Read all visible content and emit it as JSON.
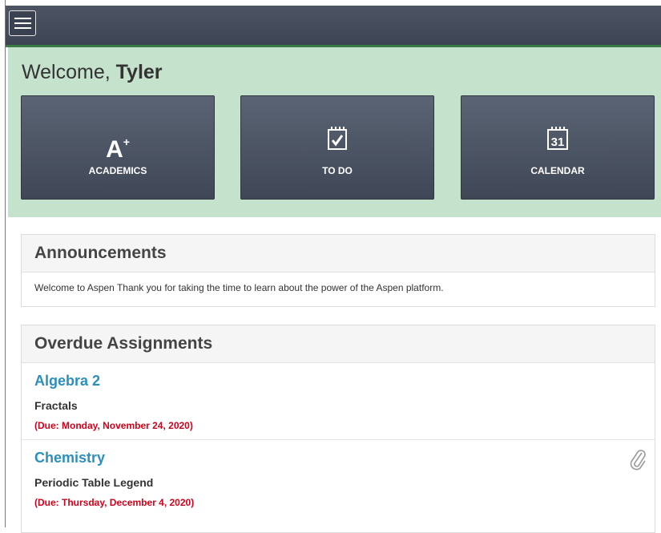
{
  "header": {
    "menu_icon": "hamburger-menu-icon"
  },
  "welcome": {
    "greeting": "Welcome,",
    "name": "Tyler"
  },
  "tiles": [
    {
      "label": "ACADEMICS",
      "icon": "a-plus-icon",
      "icon_text": "A",
      "icon_sup": "+"
    },
    {
      "label": "TO DO",
      "icon": "checklist-calendar-icon"
    },
    {
      "label": "CALENDAR",
      "icon": "calendar-icon",
      "icon_text": "31"
    }
  ],
  "announcements": {
    "title": "Announcements",
    "text": "Welcome to Aspen Thank you for taking the time to learn about the power of the Aspen platform."
  },
  "overdue": {
    "title": "Overdue Assignments",
    "items": [
      {
        "course": "Algebra 2",
        "assignment": "Fractals",
        "due": "(Due: Monday, November 24, 2020)",
        "attachment": false
      },
      {
        "course": "Chemistry",
        "assignment": "Periodic Table Legend",
        "due": "(Due: Thursday, December 4, 2020)",
        "attachment": true,
        "attachment_icon": "paperclip-icon"
      }
    ]
  },
  "colors": {
    "topbar": "#444b5a",
    "welcome_bg": "#c4e2cc",
    "link": "#2b8fbd",
    "due": "#d0021b"
  }
}
